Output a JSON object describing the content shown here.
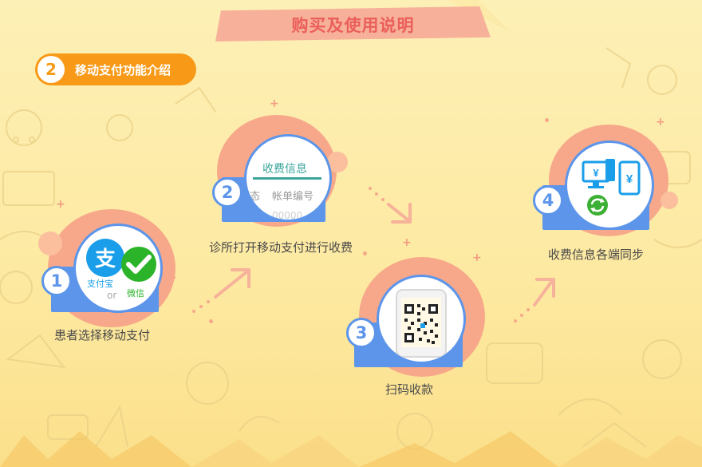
{
  "header": {
    "title": "购买及使用说明"
  },
  "section": {
    "number": "2",
    "title": "移动支付功能介绍"
  },
  "steps": [
    {
      "number": "1",
      "caption": "患者选择移动支付",
      "alipay_label": "支付宝",
      "or_label": "or",
      "wechat_label": "微信"
    },
    {
      "number": "2",
      "caption": "诊所打开移动支付进行收费",
      "tab_label": "收费信息",
      "col_status": "态",
      "col_bill": "帐单编号",
      "row_value": "00000"
    },
    {
      "number": "3",
      "caption": "扫码收款"
    },
    {
      "number": "4",
      "caption": "收费信息各端同步",
      "currency": "¥"
    }
  ],
  "colors": {
    "accent": "#f89a17",
    "blue": "#5c95e9",
    "title": "#ea5f5a",
    "alipay": "#1a9ee9",
    "wechat": "#2bb42a",
    "sync": "#3cb034"
  },
  "icons": [
    "alipay-icon",
    "wechat-icon",
    "qr-code-icon",
    "sync-icon",
    "phone-icon",
    "computer-icon"
  ]
}
